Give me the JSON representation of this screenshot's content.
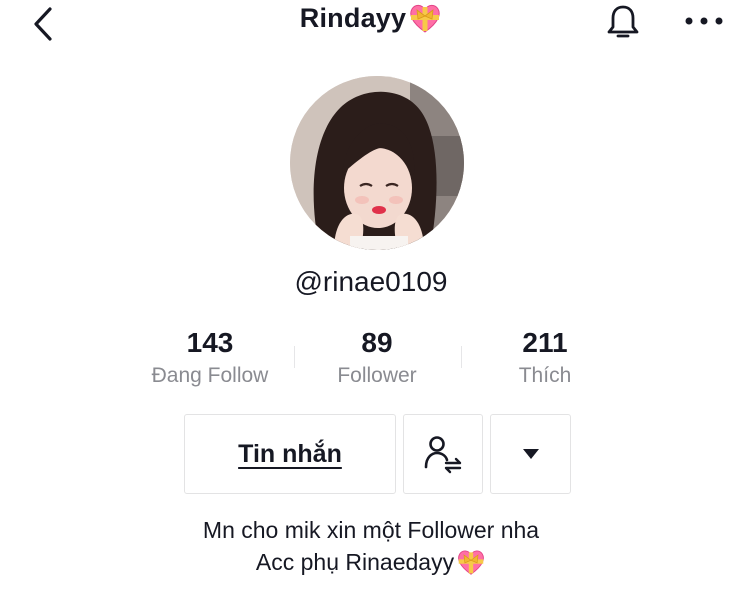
{
  "header": {
    "title": "Rindayy",
    "title_emoji": "heart-with-ribbon",
    "icons": [
      "chevron-left-icon",
      "bell-icon",
      "more-icon"
    ]
  },
  "profile": {
    "handle": "@rinae0109",
    "avatar_alt": "profile photo"
  },
  "stats": [
    {
      "value": "143",
      "label": "Đang Follow"
    },
    {
      "value": "89",
      "label": "Follower"
    },
    {
      "value": "211",
      "label": "Thích"
    }
  ],
  "actions": {
    "message_label": "Tin nhắn",
    "follow_icon": "add-friend-icon",
    "dropdown_icon": "triangle-down-icon"
  },
  "bio": {
    "line1": "Mn cho mik xin một Follower nha",
    "line2": "Acc phụ Rinaedayy",
    "line2_emoji": "heart-with-ribbon"
  },
  "colors": {
    "text": "#161823",
    "muted": "#8a8b91",
    "border": "#e3e3e4",
    "heart": "#ff6fa6",
    "ribbon": "#f7c948"
  }
}
